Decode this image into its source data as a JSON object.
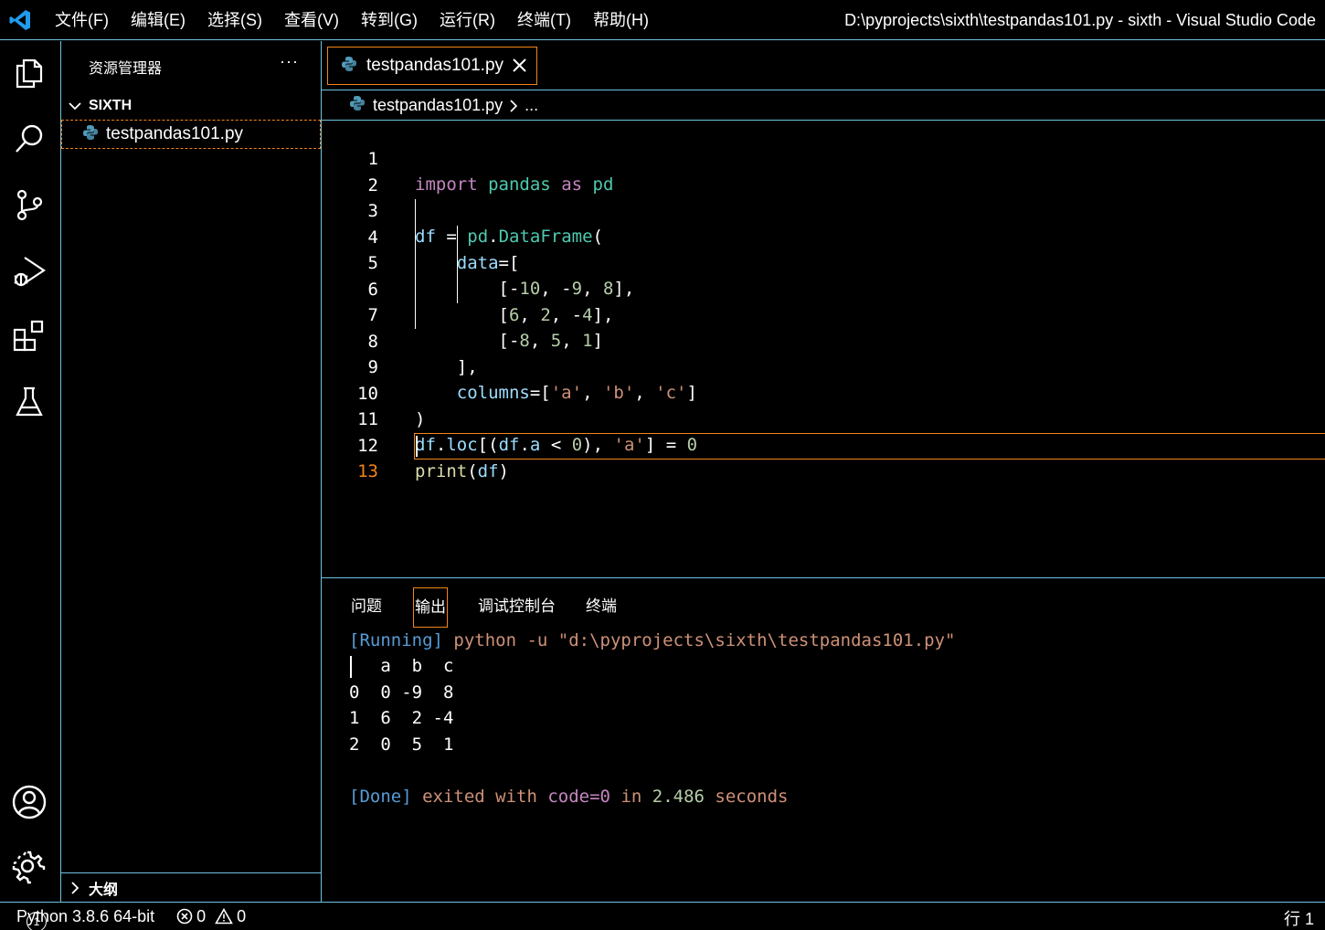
{
  "titlebar": {
    "menu": [
      "文件(F)",
      "编辑(E)",
      "选择(S)",
      "查看(V)",
      "转到(G)",
      "运行(R)",
      "终端(T)",
      "帮助(H)"
    ],
    "window_title": "D:\\pyprojects\\sixth\\testpandas101.py - sixth - Visual Studio Code"
  },
  "activitybar": {
    "icons": [
      "files-icon",
      "search-icon",
      "source-control-icon",
      "run-debug-icon",
      "extensions-icon",
      "testing-icon",
      "account-icon",
      "settings-gear-icon"
    ],
    "badge": "1"
  },
  "sidebar": {
    "title": "资源管理器",
    "more": "···",
    "folder": "SIXTH",
    "file": "testpandas101.py",
    "outline": "大纲"
  },
  "editor": {
    "tab_label": "testpandas101.py",
    "breadcrumb_file": "testpandas101.py",
    "breadcrumb_rest": "...",
    "line_numbers": [
      "1",
      "2",
      "3",
      "4",
      "5",
      "6",
      "7",
      "8",
      "9",
      "10",
      "11",
      "12",
      "13"
    ],
    "active_line": "13"
  },
  "panel": {
    "tabs": [
      "问题",
      "输出",
      "调试控制台",
      "终端"
    ],
    "active_tab": "输出",
    "output": {
      "running_tag": "[Running]",
      "running_cmd": " python -u \"d:\\pyprojects\\sixth\\testpandas101.py\"",
      "table_header": "   a  b  c",
      "rows": [
        "0  0 -9  8",
        "1  6  2 -4",
        "2  0  5  1"
      ],
      "done_tag": "[Done]",
      "done_exited": " exited with ",
      "done_code": "code=0",
      "done_in": " in ",
      "done_seconds_value": "2.486",
      "done_seconds": " seconds"
    }
  },
  "statusbar": {
    "python": "Python 3.8.6 64-bit",
    "errors": "0",
    "warnings": "0",
    "line": "行 1"
  },
  "colors": {
    "accent_border": "#6fc3df",
    "focus_border": "#f38518",
    "keyword": "#c586c0",
    "module": "#4ec9b0",
    "variable": "#9cdcfe",
    "function": "#dcdcaa",
    "number": "#b5cea8",
    "string": "#ce9178"
  }
}
